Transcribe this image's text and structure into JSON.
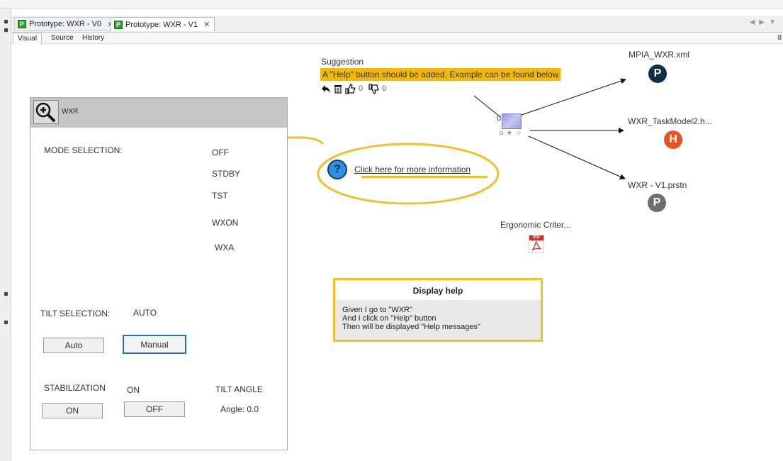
{
  "tabs": [
    {
      "badge": "P",
      "label": "Prototype: WXR - V0",
      "close": "✕"
    },
    {
      "badge": "P",
      "label": "Prototype: WXR - V1",
      "close": "✕"
    }
  ],
  "subtabs": [
    "Visual",
    "Source",
    "History"
  ],
  "right_mark": "8",
  "wxr": {
    "title": "WXR",
    "mode_selection_label": "MODE SELECTION:",
    "modes": [
      "OFF",
      "STDBY",
      "TST",
      "WXON",
      "WXA"
    ],
    "tilt_selection_label": "TILT SELECTION:",
    "tilt_value": "AUTO",
    "auto_button": "Auto",
    "manual_button": "Manual",
    "stabilization_label": "STABILIZATION",
    "stabilization_value": "ON",
    "tilt_angle_label": "TILT ANGLE",
    "on_button": "ON",
    "off_button": "OFF",
    "angle_text": "Angle: 0.0"
  },
  "suggestion": {
    "title": "Suggestion",
    "text": "A \"Help\" button should be added. Example can be found below",
    "likes": "0",
    "dislikes": "0"
  },
  "help_link": {
    "icon": "?",
    "text": "Click here for more information"
  },
  "display_help": {
    "title": "Display help",
    "lines": [
      "Given I go to \"WXR\"",
      "And I click on \"Help\" button",
      "Then will be displayed \"Help messages\""
    ]
  },
  "graph": {
    "hub_count": "0",
    "nodes": [
      {
        "label": "MPIA_WXR.xml",
        "icon": "P",
        "color": "#0f2f45"
      },
      {
        "label": "WXR_TaskModel2.h...",
        "icon": "H",
        "color": "#e8531e"
      },
      {
        "label": "WXR - V1.prstn",
        "icon": "P",
        "color": "#6e6e6e"
      }
    ],
    "pdf_label": "Ergonomic Criter...",
    "pdf_badge": "PDF"
  },
  "colors": {
    "suggestion_highlight": "#f5b800",
    "annotation_yellow": "#f2c02a",
    "selected_button_border": "#2d6fb5"
  }
}
